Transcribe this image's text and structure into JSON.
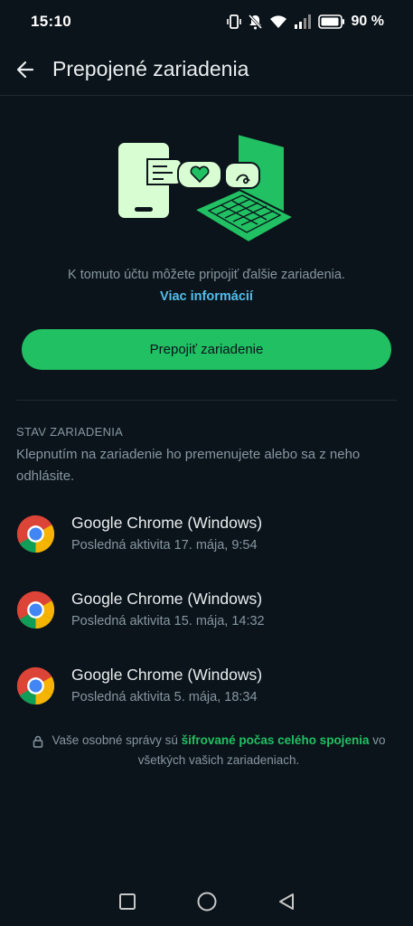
{
  "status_bar": {
    "time": "15:10",
    "battery": "90 %",
    "icons": [
      "vibrate-icon",
      "mute-icon",
      "wifi-icon",
      "signal-icon",
      "battery-icon"
    ]
  },
  "app_bar": {
    "title": "Prepojené zariadenia",
    "back_icon": "arrow-left-icon"
  },
  "info": {
    "text": "K tomuto účtu môžete pripojiť ďalšie zariadenia.",
    "link": "Viac informácií"
  },
  "link_button": {
    "label": "Prepojiť zariadenie"
  },
  "devices_section": {
    "title": "STAV ZARIADENIA",
    "description": "Klepnutím na zariadenie ho premenujete alebo sa z neho odhlásite.",
    "items": [
      {
        "name": "Google Chrome (Windows)",
        "activity": "Posledná aktivita 17. mája, 9:54",
        "icon": "chrome-icon"
      },
      {
        "name": "Google Chrome (Windows)",
        "activity": "Posledná aktivita 15. mája, 14:32",
        "icon": "chrome-icon"
      },
      {
        "name": "Google Chrome (Windows)",
        "activity": "Posledná aktivita 5. mája, 18:34",
        "icon": "chrome-icon"
      }
    ]
  },
  "e2e_note": {
    "before": "Vaše osobné správy sú ",
    "link": "šifrované počas celého spojenia",
    "after": " vo všetkých vašich zariadeniach."
  },
  "colors": {
    "background": "#0b141a",
    "accent": "#21c063",
    "link": "#53bdeb",
    "secondary_text": "#8696a0"
  },
  "nav_bar": [
    "recents-icon",
    "home-icon",
    "back-icon"
  ]
}
